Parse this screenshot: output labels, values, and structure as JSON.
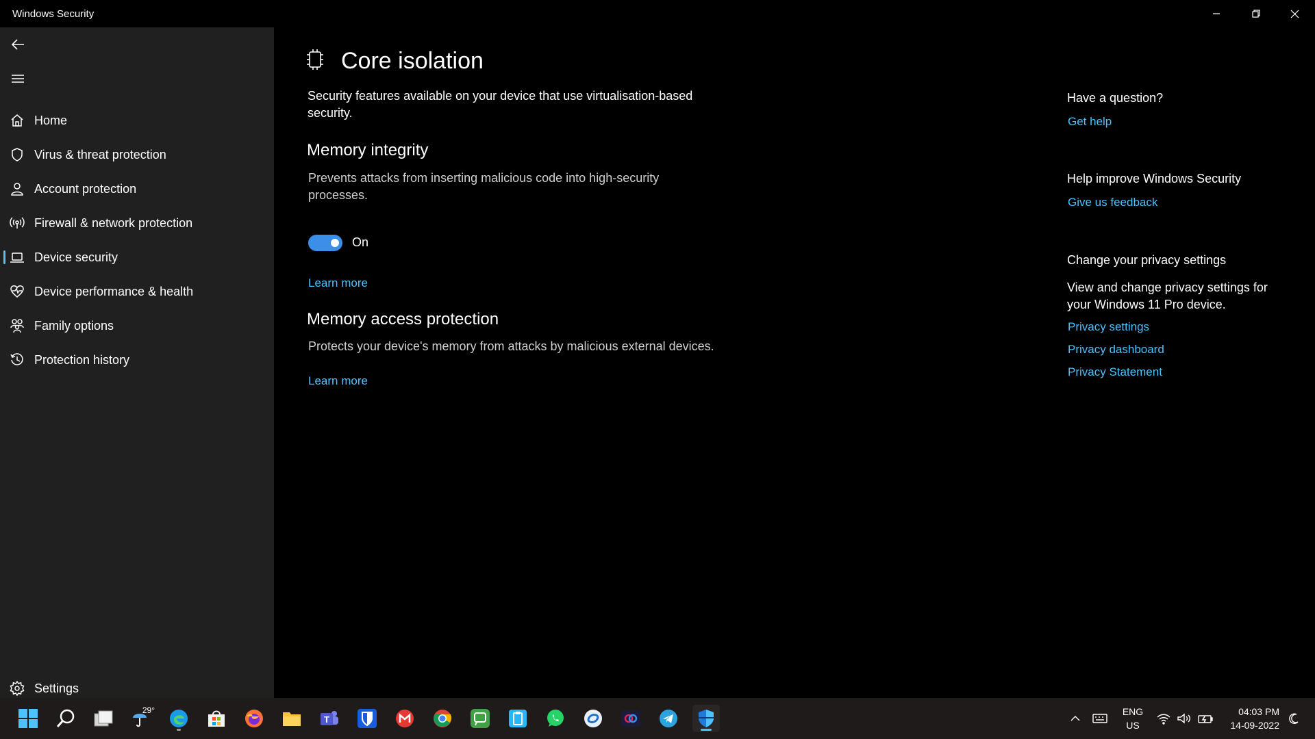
{
  "window": {
    "title": "Windows Security"
  },
  "sidebar": {
    "items": [
      {
        "label": "Home"
      },
      {
        "label": "Virus & threat protection"
      },
      {
        "label": "Account protection"
      },
      {
        "label": "Firewall & network protection"
      },
      {
        "label": "Device security"
      },
      {
        "label": "Device performance & health"
      },
      {
        "label": "Family options"
      },
      {
        "label": "Protection history"
      }
    ],
    "settings_label": "Settings"
  },
  "main": {
    "title": "Core isolation",
    "intro": "Security features available on your device that use virtualisation-based security.",
    "memory_integrity": {
      "heading": "Memory integrity",
      "description": "Prevents attacks from inserting malicious code into high-security processes.",
      "toggle_state": "On",
      "learn_more": "Learn more"
    },
    "memory_access": {
      "heading": "Memory access protection",
      "description": "Protects your device's memory from attacks by malicious external devices.",
      "learn_more": "Learn more"
    }
  },
  "aside": {
    "question_heading": "Have a question?",
    "get_help": "Get help",
    "improve_heading": "Help improve Windows Security",
    "feedback": "Give us feedback",
    "privacy_heading": "Change your privacy settings",
    "privacy_text": "View and change privacy settings for your Windows 11 Pro device.",
    "privacy_settings": "Privacy settings",
    "privacy_dashboard": "Privacy dashboard",
    "privacy_statement": "Privacy Statement"
  },
  "taskbar": {
    "weather_temp": "29°",
    "lang_top": "ENG",
    "lang_bottom": "US",
    "time": "04:03 PM",
    "date": "14-09-2022"
  },
  "colors": {
    "accent": "#4cc2ff",
    "toggle_on": "#3b8fe8",
    "sidebar_bg": "#202020",
    "taskbar_bg": "#1f1b1b"
  }
}
